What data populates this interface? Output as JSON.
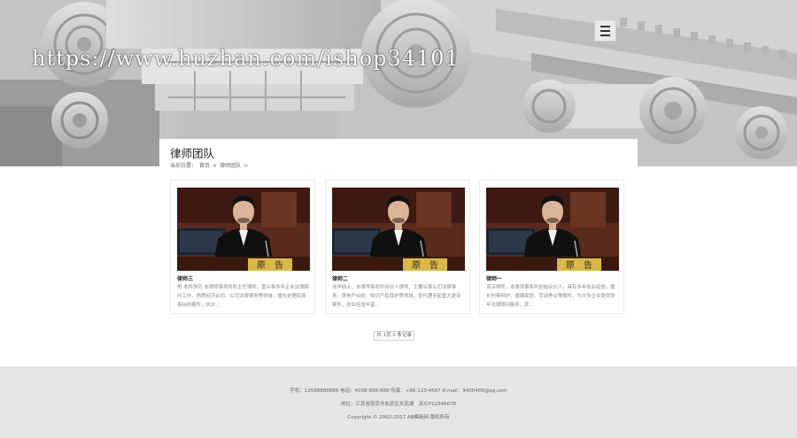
{
  "watermark": "https://www.huzhan.com/ishop34101",
  "header": {
    "menu_icon": "hamburger-menu-icon"
  },
  "page": {
    "title": "律师团队",
    "breadcrumb": [
      "当前位置：",
      "首页",
      ">",
      "律师团队",
      ">"
    ]
  },
  "lawyers": [
    {
      "name": "律师三",
      "desc": "男 本科学历 本律师事务所所主任律师，曾从事多年企业法律顾问工作，熟悉经济合同、公司法律事务等领域，擅长处理民商事纠纷案件，执业..."
    },
    {
      "name": "律师二",
      "desc": "法学硕士，本律师事务所合伙人律师，主要从事公司法律事务、房地产纠纷、知识产权保护等领域，曾代理多起重大复杂案件，执业经验丰富..."
    },
    {
      "name": "律师一",
      "desc": "资深律师，本律师事务所创始合伙人，具有多年执业经验，擅长刑事辩护、婚姻家庭、劳动争议等案件，为众多企业提供常年法律顾问服务，获..."
    }
  ],
  "pagination": {
    "label": "共 1页 1 条记录"
  },
  "footer": {
    "contact": "手机：13588888888 电话：4008-888-888 传真：+86-123-4567 E-mail：9400489@qq.com",
    "address": "地址：江苏省南京市玄武区玄武湖　苏ICP12345678",
    "copyright": "Copyright © 2002-2017 AB模板网 版权所有"
  },
  "colors": {
    "hero_stone": "#c8c8c8",
    "footer_bg": "#e6e6e6",
    "photo_wood": "#5a2a1c",
    "sign_gold": "#d9b84a"
  }
}
